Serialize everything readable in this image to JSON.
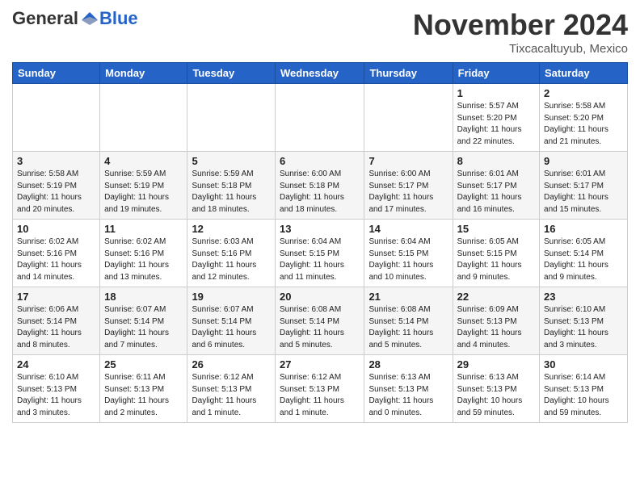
{
  "header": {
    "logo_general": "General",
    "logo_blue": "Blue",
    "month_title": "November 2024",
    "subtitle": "Tixcacaltuyub, Mexico"
  },
  "weekdays": [
    "Sunday",
    "Monday",
    "Tuesday",
    "Wednesday",
    "Thursday",
    "Friday",
    "Saturday"
  ],
  "weeks": [
    [
      {
        "day": "",
        "info": ""
      },
      {
        "day": "",
        "info": ""
      },
      {
        "day": "",
        "info": ""
      },
      {
        "day": "",
        "info": ""
      },
      {
        "day": "",
        "info": ""
      },
      {
        "day": "1",
        "info": "Sunrise: 5:57 AM\nSunset: 5:20 PM\nDaylight: 11 hours\nand 22 minutes."
      },
      {
        "day": "2",
        "info": "Sunrise: 5:58 AM\nSunset: 5:20 PM\nDaylight: 11 hours\nand 21 minutes."
      }
    ],
    [
      {
        "day": "3",
        "info": "Sunrise: 5:58 AM\nSunset: 5:19 PM\nDaylight: 11 hours\nand 20 minutes."
      },
      {
        "day": "4",
        "info": "Sunrise: 5:59 AM\nSunset: 5:19 PM\nDaylight: 11 hours\nand 19 minutes."
      },
      {
        "day": "5",
        "info": "Sunrise: 5:59 AM\nSunset: 5:18 PM\nDaylight: 11 hours\nand 18 minutes."
      },
      {
        "day": "6",
        "info": "Sunrise: 6:00 AM\nSunset: 5:18 PM\nDaylight: 11 hours\nand 18 minutes."
      },
      {
        "day": "7",
        "info": "Sunrise: 6:00 AM\nSunset: 5:17 PM\nDaylight: 11 hours\nand 17 minutes."
      },
      {
        "day": "8",
        "info": "Sunrise: 6:01 AM\nSunset: 5:17 PM\nDaylight: 11 hours\nand 16 minutes."
      },
      {
        "day": "9",
        "info": "Sunrise: 6:01 AM\nSunset: 5:17 PM\nDaylight: 11 hours\nand 15 minutes."
      }
    ],
    [
      {
        "day": "10",
        "info": "Sunrise: 6:02 AM\nSunset: 5:16 PM\nDaylight: 11 hours\nand 14 minutes."
      },
      {
        "day": "11",
        "info": "Sunrise: 6:02 AM\nSunset: 5:16 PM\nDaylight: 11 hours\nand 13 minutes."
      },
      {
        "day": "12",
        "info": "Sunrise: 6:03 AM\nSunset: 5:16 PM\nDaylight: 11 hours\nand 12 minutes."
      },
      {
        "day": "13",
        "info": "Sunrise: 6:04 AM\nSunset: 5:15 PM\nDaylight: 11 hours\nand 11 minutes."
      },
      {
        "day": "14",
        "info": "Sunrise: 6:04 AM\nSunset: 5:15 PM\nDaylight: 11 hours\nand 10 minutes."
      },
      {
        "day": "15",
        "info": "Sunrise: 6:05 AM\nSunset: 5:15 PM\nDaylight: 11 hours\nand 9 minutes."
      },
      {
        "day": "16",
        "info": "Sunrise: 6:05 AM\nSunset: 5:14 PM\nDaylight: 11 hours\nand 9 minutes."
      }
    ],
    [
      {
        "day": "17",
        "info": "Sunrise: 6:06 AM\nSunset: 5:14 PM\nDaylight: 11 hours\nand 8 minutes."
      },
      {
        "day": "18",
        "info": "Sunrise: 6:07 AM\nSunset: 5:14 PM\nDaylight: 11 hours\nand 7 minutes."
      },
      {
        "day": "19",
        "info": "Sunrise: 6:07 AM\nSunset: 5:14 PM\nDaylight: 11 hours\nand 6 minutes."
      },
      {
        "day": "20",
        "info": "Sunrise: 6:08 AM\nSunset: 5:14 PM\nDaylight: 11 hours\nand 5 minutes."
      },
      {
        "day": "21",
        "info": "Sunrise: 6:08 AM\nSunset: 5:14 PM\nDaylight: 11 hours\nand 5 minutes."
      },
      {
        "day": "22",
        "info": "Sunrise: 6:09 AM\nSunset: 5:13 PM\nDaylight: 11 hours\nand 4 minutes."
      },
      {
        "day": "23",
        "info": "Sunrise: 6:10 AM\nSunset: 5:13 PM\nDaylight: 11 hours\nand 3 minutes."
      }
    ],
    [
      {
        "day": "24",
        "info": "Sunrise: 6:10 AM\nSunset: 5:13 PM\nDaylight: 11 hours\nand 3 minutes."
      },
      {
        "day": "25",
        "info": "Sunrise: 6:11 AM\nSunset: 5:13 PM\nDaylight: 11 hours\nand 2 minutes."
      },
      {
        "day": "26",
        "info": "Sunrise: 6:12 AM\nSunset: 5:13 PM\nDaylight: 11 hours\nand 1 minute."
      },
      {
        "day": "27",
        "info": "Sunrise: 6:12 AM\nSunset: 5:13 PM\nDaylight: 11 hours\nand 1 minute."
      },
      {
        "day": "28",
        "info": "Sunrise: 6:13 AM\nSunset: 5:13 PM\nDaylight: 11 hours\nand 0 minutes."
      },
      {
        "day": "29",
        "info": "Sunrise: 6:13 AM\nSunset: 5:13 PM\nDaylight: 10 hours\nand 59 minutes."
      },
      {
        "day": "30",
        "info": "Sunrise: 6:14 AM\nSunset: 5:13 PM\nDaylight: 10 hours\nand 59 minutes."
      }
    ]
  ]
}
